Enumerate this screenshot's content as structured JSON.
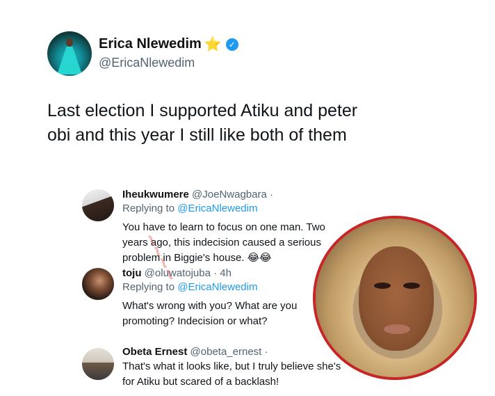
{
  "main_tweet": {
    "display_name": "Erica Nlewedim",
    "name_emoji": "⭐",
    "verified": true,
    "handle": "@EricaNlewedim",
    "text": "Last election I supported Atiku and peter obi and this year I still like both of them"
  },
  "replies": [
    {
      "display_name": "Iheukwumere",
      "handle": "@JoeNwagbara ·",
      "replying_prefix": "Replying to",
      "replying_to": "@EricaNlewedim",
      "body": "You have to learn to focus on one man. Two years ago, this indecision caused a serious problem in Biggie's house. 😂😂"
    },
    {
      "display_name": "toju",
      "handle": "@oluwatojuba · 4h",
      "replying_prefix": "Replying to",
      "replying_to": "@EricaNlewedim",
      "body": "What's wrong with you? What are you promoting? Indecision or what?"
    },
    {
      "display_name": "Obeta Ernest",
      "handle": "@obeta_ernest ·",
      "body": "That's what it looks like, but I truly believe she's for Atiku but scared of a backlash!"
    }
  ],
  "colors": {
    "verified_blue": "#1d9bf0",
    "mention_blue": "#1d9bf0",
    "inset_border": "#c62626",
    "handle_gray": "#536471"
  },
  "icons": {
    "verified": "verified-badge-icon",
    "star": "star-icon"
  }
}
